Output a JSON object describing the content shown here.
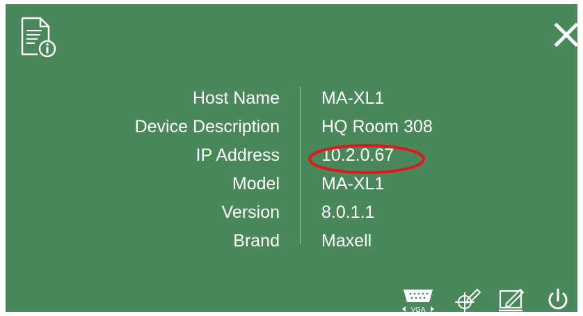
{
  "dialog": {
    "icons": {
      "info": "document-info-icon",
      "close": "close-icon"
    },
    "rows": [
      {
        "label": "Host Name",
        "value": "MA-XL1"
      },
      {
        "label": "Device Description",
        "value": "HQ Room 308"
      },
      {
        "label": "IP Address",
        "value": "10.2.0.67"
      },
      {
        "label": "Model",
        "value": "MA-XL1"
      },
      {
        "label": "Version",
        "value": "8.0.1.1"
      },
      {
        "label": "Brand",
        "value": "Maxell"
      }
    ],
    "highlight_color": "#e0181c",
    "background_color": "#4a875a"
  },
  "toolbar": {
    "vga_label": "VGA",
    "icons": [
      "vga-icon",
      "target-pen-icon",
      "screen-edit-icon",
      "power-icon"
    ]
  }
}
